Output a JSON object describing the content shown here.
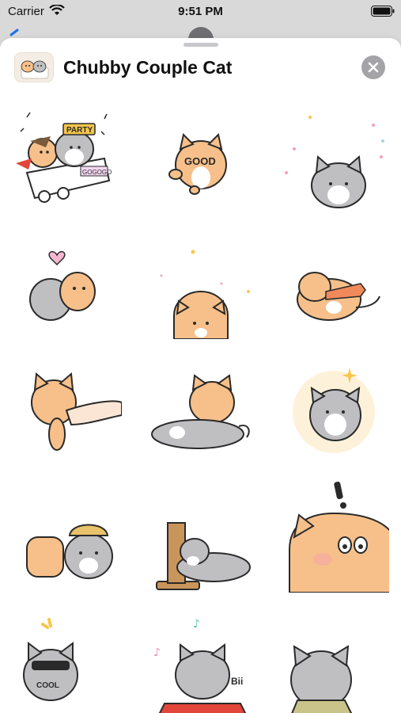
{
  "status_bar": {
    "carrier": "Carrier",
    "time": "9:51 PM"
  },
  "sheet": {
    "title": "Chubby Couple Cat"
  },
  "colors": {
    "orange_cat": "#f7c08a",
    "gray_cat": "#bfbfc2",
    "outline": "#2a2a2a",
    "close_button": "#a3a3a8"
  },
  "stickers": [
    {
      "name": "party-cart",
      "badge_text": "PARTY",
      "side_text": "GOGOGO"
    },
    {
      "name": "orange-cat-good",
      "badge_text": "GOOD"
    },
    {
      "name": "gray-cat-confetti"
    },
    {
      "name": "hug-heart"
    },
    {
      "name": "orange-cat-peek"
    },
    {
      "name": "orange-cat-fish"
    },
    {
      "name": "orange-cat-hand"
    },
    {
      "name": "cats-lying"
    },
    {
      "name": "gray-cat-sparkle"
    },
    {
      "name": "cats-hat"
    },
    {
      "name": "scratching-post"
    },
    {
      "name": "orange-cat-big-exclaim"
    },
    {
      "name": "gray-cat-cool",
      "badge_text": "COOL"
    },
    {
      "name": "gray-cat-drive",
      "badge_text": "Bii"
    },
    {
      "name": "gray-cat-coat"
    }
  ]
}
